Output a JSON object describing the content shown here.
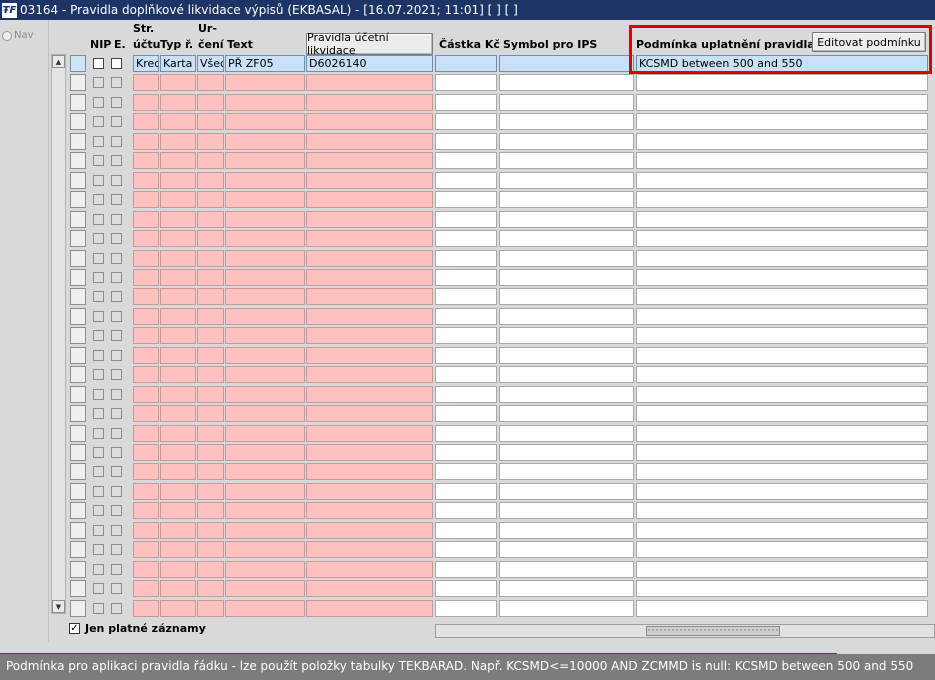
{
  "window": {
    "logo_text": "ŦF",
    "title": "03164 - Pravidla doplňkové likvidace výpisů (EKBASAL) - [16.07.2021; 11:01] [ ] [ ]"
  },
  "nav_label": "Nav",
  "columns": {
    "nip": "NIP",
    "e": "E.",
    "str_l1": "Str.",
    "str_l2": "účtu",
    "typ": "Typ ř.",
    "urc_l1": "Ur-",
    "urc_l2": "čení",
    "text": "Text",
    "pravidla_btn": "Pravidla účetní likvidace",
    "castka": "Částka Kč",
    "symbol": "Symbol pro IPS",
    "podminka": "Podmínka uplatnění pravidla",
    "edit_btn": "Editovat podmínku"
  },
  "first_row": {
    "str": "Kred",
    "typ": "Karta",
    "urc": "Všec",
    "text": "PŘ ZF05",
    "pravidla": "D6026140",
    "castka": "",
    "symbol": "",
    "podminka": "KCSMD between 500 and 550"
  },
  "footer": {
    "checkbox_label": "Jen platné záznamy",
    "checkbox_checked": true
  },
  "status": "Podmínka pro aplikaci pravidla řádku - lze použít položky tabulky TEKBARAD. Např. KCSMD<=10000 AND ZCMMD is null: KCSMD between 500 and 550",
  "colors": {
    "title_bg": "#1c3566",
    "required_cell": "#ffc0c0",
    "selected_cell": "#c8e0f8",
    "highlight_frame": "#e00000"
  }
}
